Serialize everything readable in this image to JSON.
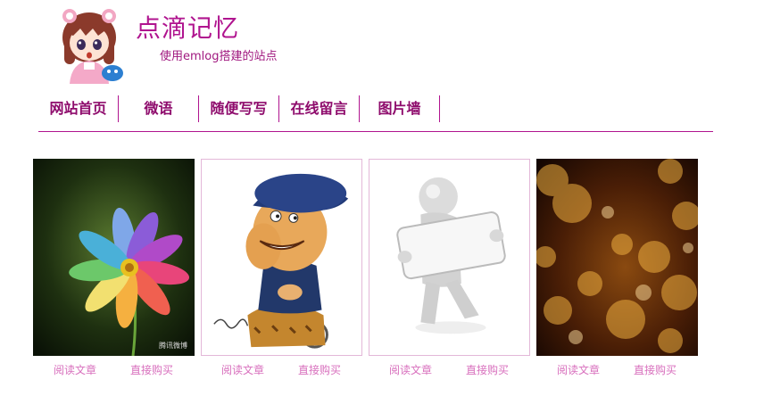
{
  "site": {
    "title": "点滴记忆",
    "subtitle": "使用emlog搭建的站点"
  },
  "nav": {
    "items": [
      "网站首页",
      "微语",
      "随便写写",
      "在线留言",
      "图片墙"
    ]
  },
  "gallery": {
    "cards": [
      {
        "image": "rainbow-flower-photo",
        "read_label": "阅读文章",
        "buy_label": "直接购买",
        "watermark": "腾讯微博"
      },
      {
        "image": "caricature-man-wheelchair",
        "read_label": "阅读文章",
        "buy_label": "直接购买"
      },
      {
        "image": "3d-figure-holding-sign",
        "read_label": "阅读文章",
        "buy_label": "直接购买"
      },
      {
        "image": "golden-bokeh-lights",
        "read_label": "阅读文章",
        "buy_label": "直接购买"
      }
    ]
  },
  "colors": {
    "brand": "#b0148f",
    "nav_text": "#8e0b6c",
    "link": "#d86fbd"
  }
}
